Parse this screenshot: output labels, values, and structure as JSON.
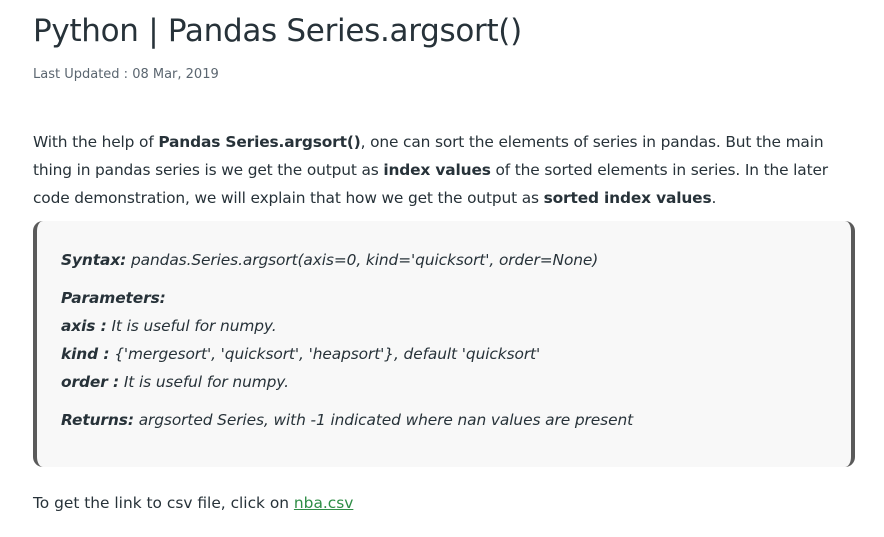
{
  "article": {
    "title": "Python | Pandas Series.argsort()",
    "last_updated": "Last Updated : 08 Mar, 2019",
    "intro": {
      "t1": "With the help of ",
      "b1": "Pandas Series.argsort()",
      "t2": ", one can sort the elements of series in pandas. But the main thing in pandas series is we get the output as ",
      "b2": "index values",
      "t3": " of the sorted elements in series. In the later code demonstration, we will explain that how we get the output as ",
      "b3": "sorted index values",
      "t4": "."
    }
  },
  "syntax_box": {
    "syntax_label": "Syntax:",
    "syntax_value": " pandas.Series.argsort(axis=0, kind='quicksort', order=None)",
    "parameters_label": "Parameters:",
    "params": [
      {
        "name": "axis :",
        "desc": " It is useful for numpy."
      },
      {
        "name": "kind :",
        "desc": " {'mergesort', 'quicksort', 'heapsort'}, default 'quicksort'"
      },
      {
        "name": "order :",
        "desc": " It is useful for numpy."
      }
    ],
    "returns_label": "Returns:",
    "returns_value": " argsorted Series, with -1 indicated where nan values are present"
  },
  "footer": {
    "text": "To get the link to csv file, click on ",
    "link_text": "nba.csv"
  },
  "colors": {
    "text": "#273239",
    "link": "#2f8d46",
    "box_bg": "#f8f8f8",
    "box_border": "#5a5a5a"
  }
}
